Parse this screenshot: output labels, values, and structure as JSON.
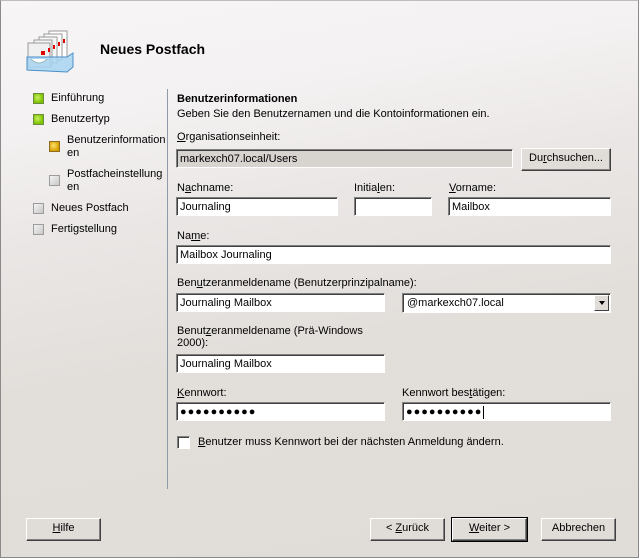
{
  "window": {
    "title": "Neues Postfach",
    "header_icon": "mailbox-tray-icon"
  },
  "nav": {
    "items": [
      {
        "label": "Einführung",
        "state": "done"
      },
      {
        "label": "Benutzertyp",
        "state": "done"
      },
      {
        "label": "Benutzerinformation en",
        "line1": "Benutzerinformation",
        "line2": "en",
        "state": "current"
      },
      {
        "label": "Postfacheinstellung en",
        "line1": "Postfacheinstellung",
        "line2": "en",
        "state": "todo"
      },
      {
        "label": "Neues Postfach",
        "state": "todo"
      },
      {
        "label": "Fertigstellung",
        "state": "todo"
      }
    ]
  },
  "form": {
    "section_title": "Benutzerinformationen",
    "section_desc": "Geben Sie den Benutzernamen und die Kontoinformationen ein.",
    "org_unit": {
      "label_u": "O",
      "label_rest": "rganisationseinheit:",
      "value": "markexch07.local/Users"
    },
    "browse_button": {
      "pre": "Du",
      "u": "r",
      "post": "chsuchen..."
    },
    "lastname": {
      "pre": "N",
      "u": "a",
      "post": "chname:",
      "value": "Journaling"
    },
    "initials": {
      "pre": "Initia",
      "u": "l",
      "post": "en:",
      "value": ""
    },
    "firstname": {
      "pre": "",
      "u": "V",
      "post": "orname:",
      "value": "Mailbox"
    },
    "name": {
      "pre": "Na",
      "u": "m",
      "post": "e:",
      "value": "Mailbox Journaling"
    },
    "upn": {
      "pre": "Ben",
      "u": "u",
      "post": "tzeranmeldename (Benutzerprinzipalname):",
      "value": "Journaling Mailbox",
      "domain": "@markexch07.local"
    },
    "pre2000": {
      "pre": "Benut",
      "u": "z",
      "post": "eranmeldename (Prä-Windows",
      "line2": "2000):",
      "value": "Journaling Mailbox"
    },
    "password": {
      "pre": "",
      "u": "K",
      "post": "ennwort:",
      "value": "●●●●●●●●●●"
    },
    "password_confirm": {
      "pre": "Kennwort bes",
      "u": "t",
      "post": "ätigen:",
      "value": "●●●●●●●●●●"
    },
    "must_change": {
      "pre": "",
      "u": "B",
      "post": "enutzer muss Kennwort bei der nächsten Anmeldung ändern.",
      "checked": false
    }
  },
  "footer": {
    "help": {
      "pre": "",
      "u": "H",
      "post": "ilfe"
    },
    "back": {
      "pre": "< ",
      "u": "Z",
      "post": "urück"
    },
    "next": {
      "pre": "",
      "u": "W",
      "post": "eiter >"
    },
    "cancel": {
      "label": "Abbrechen"
    }
  }
}
